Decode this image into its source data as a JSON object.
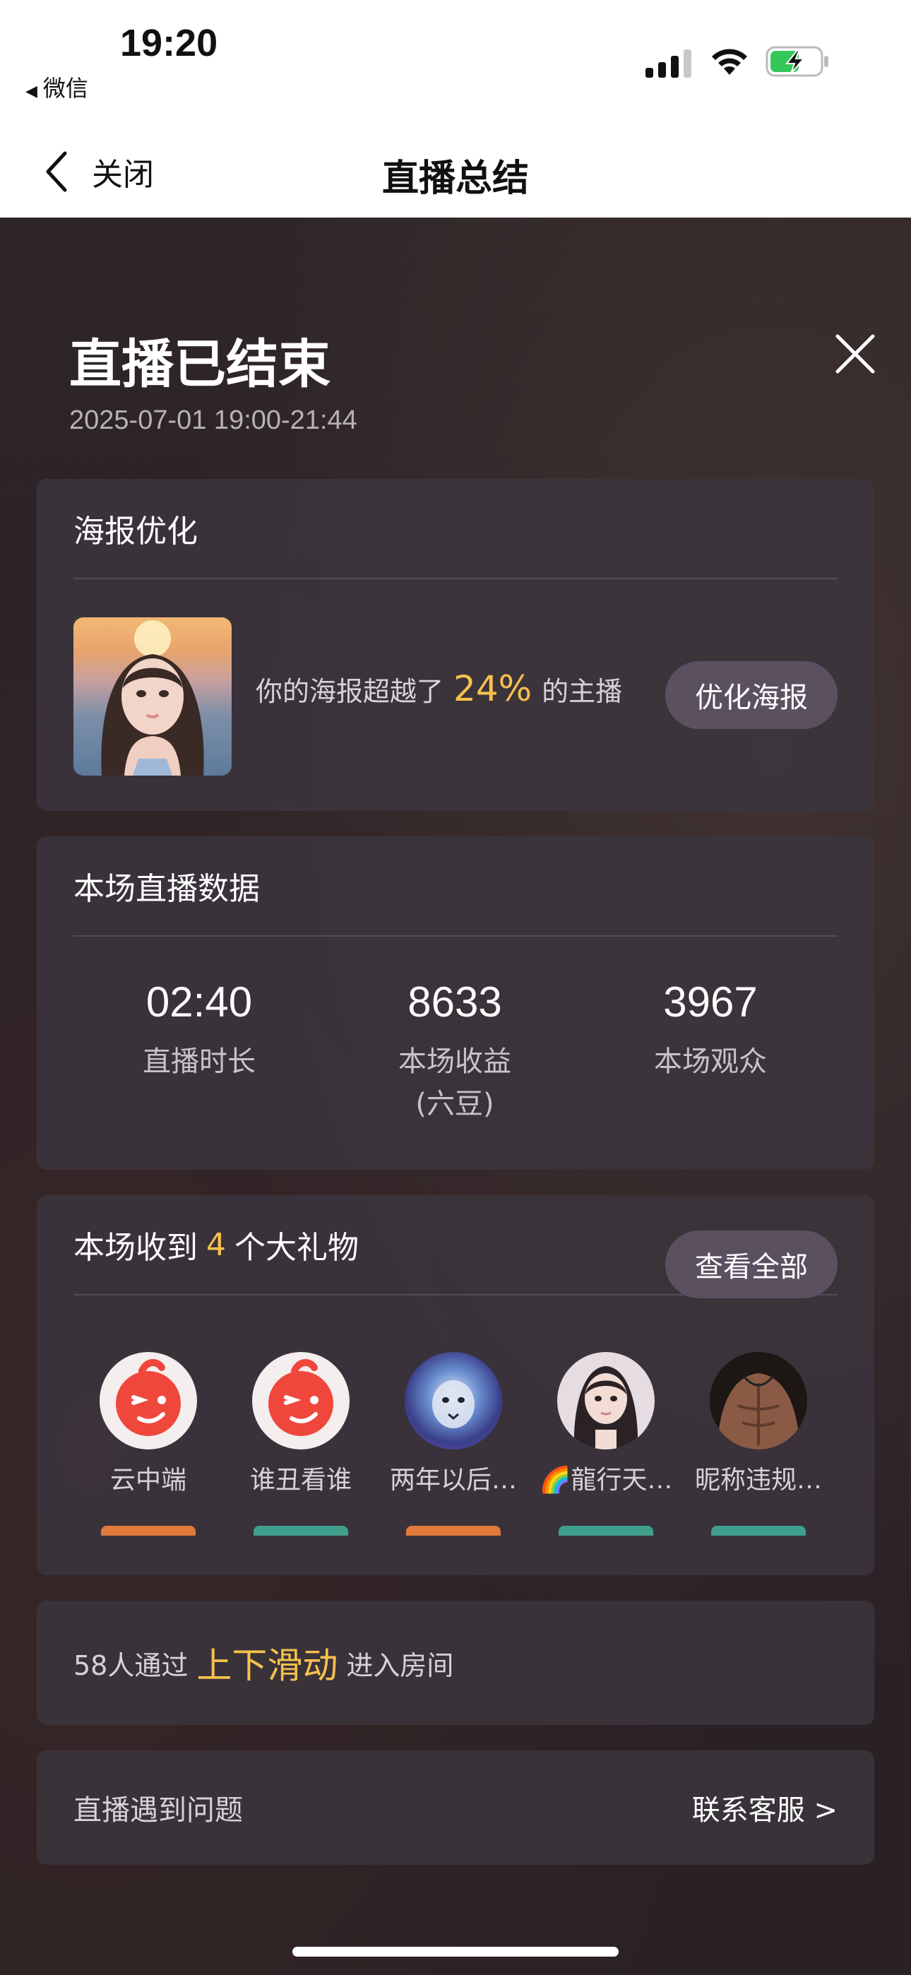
{
  "status_bar": {
    "time": "19:20",
    "back_app": "微信"
  },
  "nav": {
    "back_label": "关闭",
    "title": "直播总结"
  },
  "summary": {
    "title": "直播已结束",
    "time_range": "2025-07-01 19:00-21:44"
  },
  "poster_card": {
    "title": "海报优化",
    "text_before": "你的海报超越了",
    "percent": "24%",
    "text_after": "的主播",
    "button": "优化海报"
  },
  "stats_card": {
    "title": "本场直播数据",
    "items": [
      {
        "value": "02:40",
        "label": "直播时长",
        "sub": ""
      },
      {
        "value": "8633",
        "label": "本场收益",
        "sub": "(六豆)"
      },
      {
        "value": "3967",
        "label": "本场观众",
        "sub": ""
      }
    ]
  },
  "gifts_card": {
    "title_before": "本场收到",
    "count": "4",
    "title_after": "个大礼物",
    "button": "查看全部",
    "users": [
      {
        "name": "云中端",
        "avatar": "wink-face-icon"
      },
      {
        "name": "谁丑看谁",
        "avatar": "wink-face-icon"
      },
      {
        "name": "两年以后…",
        "avatar": "lion-photo"
      },
      {
        "name": "🌈龍行天…",
        "avatar": "girl-photo"
      },
      {
        "name": "昵称违规…",
        "avatar": "torso-photo"
      }
    ]
  },
  "swipe_card": {
    "text_before": "58人通过",
    "highlight": "上下滑动",
    "text_after": "进入房间"
  },
  "help_card": {
    "label": "直播遇到问题",
    "link": "联系客服 >"
  },
  "colors": {
    "highlight": "#f5c14e",
    "pill": "#5b5060",
    "card": "#3c363e"
  }
}
